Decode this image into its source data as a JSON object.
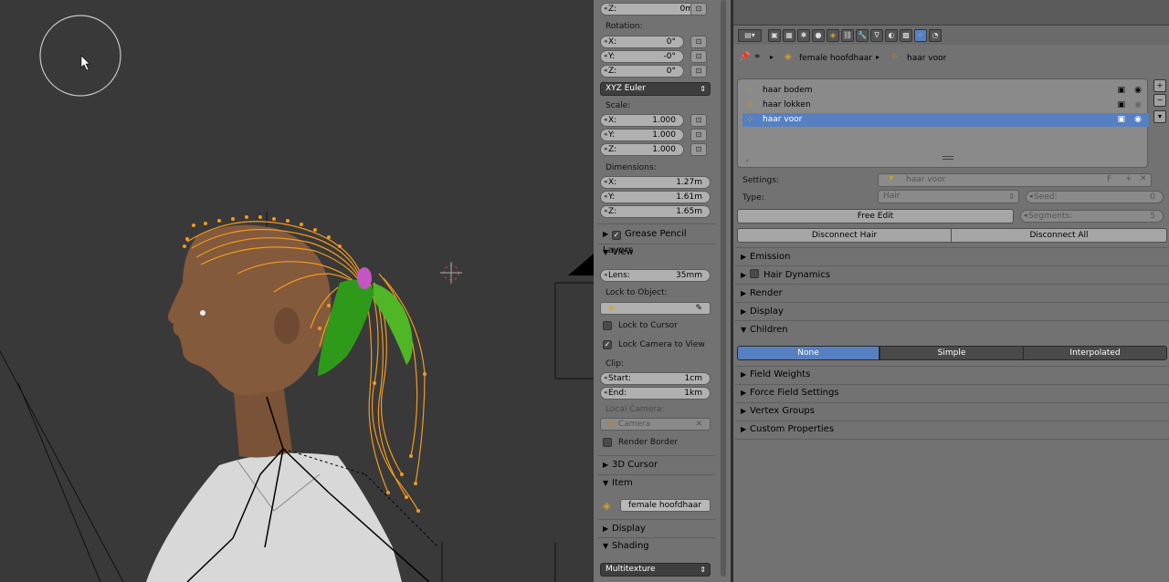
{
  "n_panel": {
    "location_z": {
      "label": "Z:",
      "value": "0m"
    },
    "rotation_label": "Rotation:",
    "rotation": [
      {
        "label": "X:",
        "value": "0°"
      },
      {
        "label": "Y:",
        "value": "-0°"
      },
      {
        "label": "Z:",
        "value": "0°"
      }
    ],
    "rotation_mode": "XYZ Euler",
    "scale_label": "Scale:",
    "scale": [
      {
        "label": "X:",
        "value": "1.000"
      },
      {
        "label": "Y:",
        "value": "1.000"
      },
      {
        "label": "Z:",
        "value": "1.000"
      }
    ],
    "dimensions_label": "Dimensions:",
    "dimensions": [
      {
        "label": "X:",
        "value": "1.27m"
      },
      {
        "label": "Y:",
        "value": "1.61m"
      },
      {
        "label": "Z:",
        "value": "1.65m"
      }
    ],
    "grease_pencil": "Grease Pencil Layers",
    "view_header": "View",
    "lens": {
      "label": "Lens:",
      "value": "35mm"
    },
    "lock_to_object": "Lock to Object:",
    "lock_to_cursor": "Lock to Cursor",
    "lock_camera_to_view": "Lock Camera to View",
    "clip_label": "Clip:",
    "clip_start": {
      "label": "Start:",
      "value": "1cm"
    },
    "clip_end": {
      "label": "End:",
      "value": "1km"
    },
    "local_camera_label": "Local Camera:",
    "local_camera_value": "Camera",
    "render_border": "Render Border",
    "cursor_header": "3D Cursor",
    "item_header": "Item",
    "item_name": "female hoofdhaar",
    "display_header": "Display",
    "shading_header": "Shading",
    "shading_mode": "Multitexture"
  },
  "props": {
    "breadcrumb_object": "female hoofdhaar",
    "breadcrumb_system": "haar voor",
    "particle_systems": [
      {
        "name": "haar bodem",
        "selected": false
      },
      {
        "name": "haar lokken",
        "selected": false
      },
      {
        "name": "haar voor",
        "selected": true
      }
    ],
    "settings_label": "Settings:",
    "settings_value": "haar voor",
    "settings_f": "F",
    "type_label": "Type:",
    "type_value": "Hair",
    "seed_label": "Seed:",
    "seed_value": "0",
    "free_edit": "Free Edit",
    "segments_label": "Segments:",
    "segments_value": "5",
    "disconnect_hair": "Disconnect Hair",
    "disconnect_all": "Disconnect All",
    "sections_top": [
      "Emission",
      "Hair Dynamics",
      "Render",
      "Display"
    ],
    "children_header": "Children",
    "children_tabs": [
      {
        "label": "None",
        "active": true
      },
      {
        "label": "Simple",
        "active": false
      },
      {
        "label": "Interpolated",
        "active": false
      }
    ],
    "sections_bottom": [
      "Field Weights",
      "Force Field Settings",
      "Vertex Groups",
      "Custom Properties"
    ]
  },
  "colors": {
    "accent": "#5680c2",
    "hair_orange": "#f39a1e",
    "hair_green": "#2f9a1a",
    "background": "#393939",
    "panel": "#727272"
  }
}
